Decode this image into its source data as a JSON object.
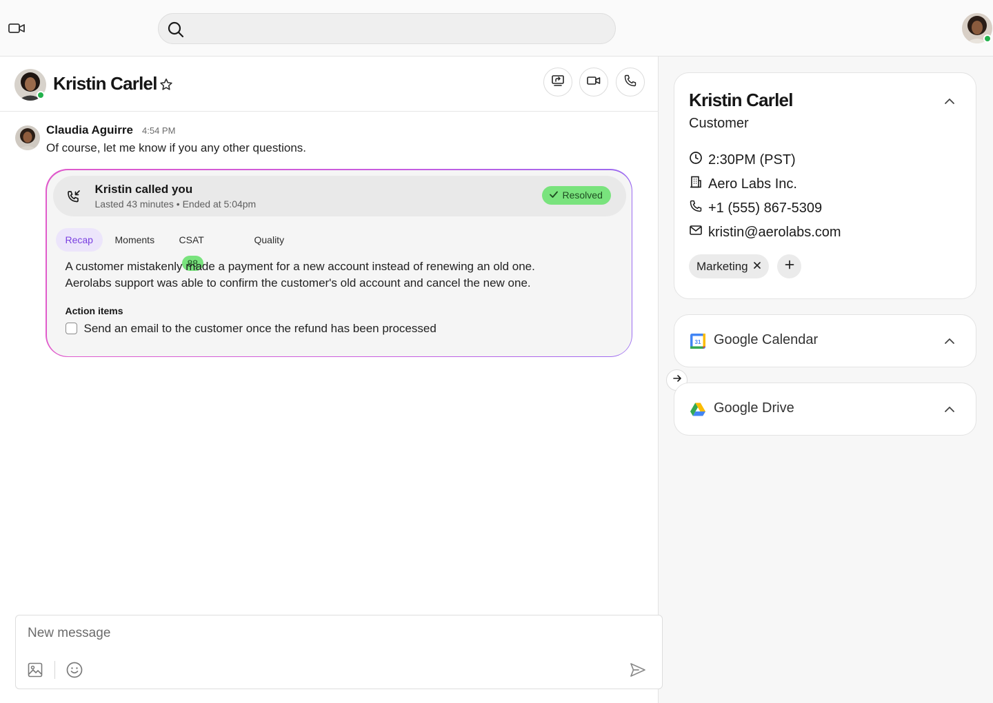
{
  "search": {
    "placeholder": ""
  },
  "chat": {
    "contact_name": "Kristin Carlel",
    "message": {
      "sender": "Claudia Aguirre",
      "time": "4:54 PM",
      "text": "Of course, let me know if you any other questions."
    },
    "call": {
      "title": "Kristin called you",
      "subtitle": "Lasted 43 minutes • Ended at 5:04pm",
      "status": "Resolved",
      "tabs": [
        {
          "label": "Recap",
          "active": true
        },
        {
          "label": "Moments",
          "active": false
        },
        {
          "label": "CSAT",
          "active": false,
          "badge": "88"
        },
        {
          "label": "Quality",
          "active": false
        }
      ],
      "recap_lines": [
        "A customer mistakenly made a payment for a new account instead of renewing an old one.",
        "Aerolabs support was able to confirm the customer's old account and cancel the new one."
      ],
      "action_items_title": "Action items",
      "action_items": [
        {
          "text": "Send an email to the customer once the refund has been processed",
          "checked": false
        }
      ]
    },
    "composer": {
      "placeholder": "New message"
    }
  },
  "contact": {
    "name": "Kristin Carlel",
    "role": "Customer",
    "local_time": "2:30PM (PST)",
    "company": "Aero Labs Inc.",
    "phone": "+1 (555) 867-5309",
    "email": "kristin@aerolabs.com",
    "tags": [
      "Marketing"
    ]
  },
  "integrations": [
    {
      "label": "Google Calendar",
      "icon": "google-calendar-icon"
    },
    {
      "label": "Google Drive",
      "icon": "google-drive-icon"
    }
  ],
  "colors": {
    "online": "#22b14c",
    "resolved_bg": "#79e37d",
    "recap_tab_bg": "#ece5fb",
    "recap_tab_text": "#7a3fe0",
    "card_gradient_start": "#e05acb",
    "card_gradient_end": "#9b6bf0"
  }
}
